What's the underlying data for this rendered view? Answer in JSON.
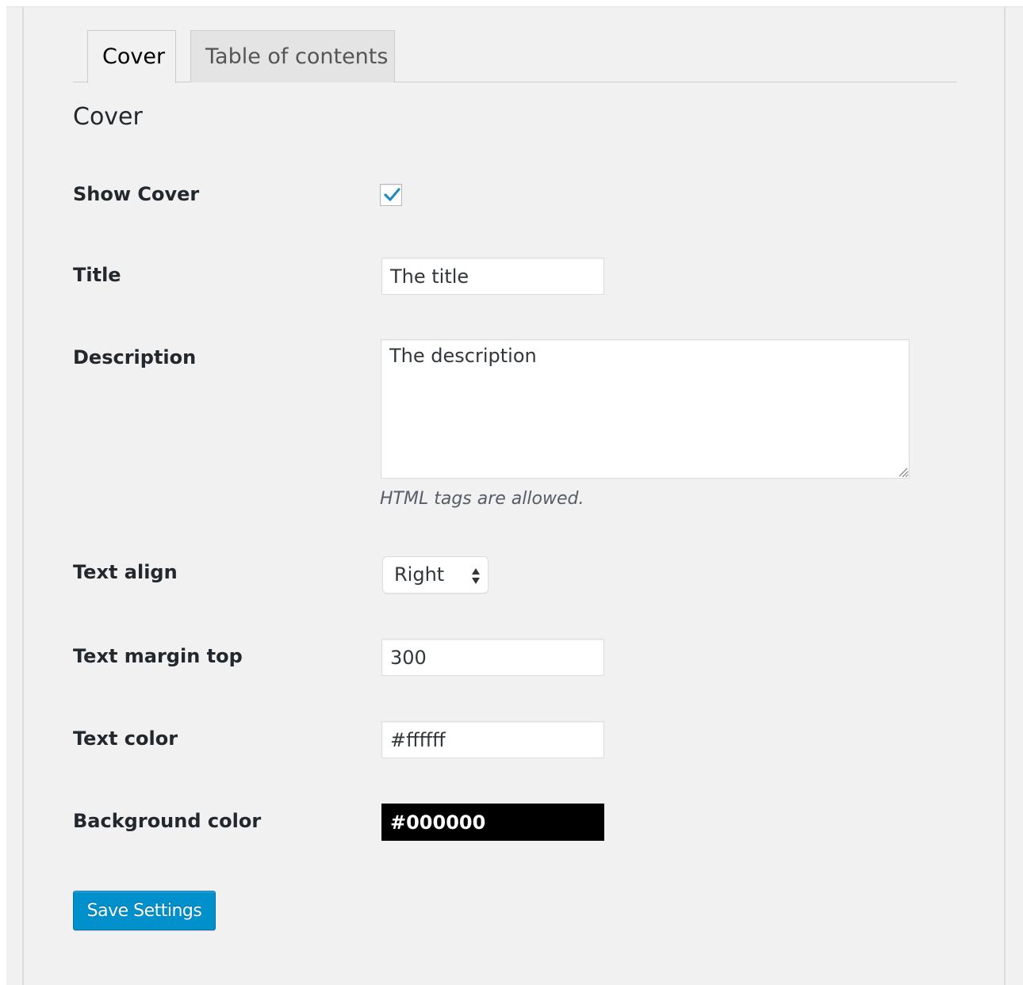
{
  "tabs": [
    {
      "label": "Cover",
      "active": true
    },
    {
      "label": "Table of contents",
      "active": false
    }
  ],
  "section_title": "Cover",
  "fields": {
    "show_cover": {
      "label": "Show Cover",
      "checked": true
    },
    "title": {
      "label": "Title",
      "value": "The title"
    },
    "description": {
      "label": "Description",
      "value": "The description",
      "hint": "HTML tags are allowed."
    },
    "text_align": {
      "label": "Text align",
      "value": "Right"
    },
    "text_margin_top": {
      "label": "Text margin top",
      "value": "300"
    },
    "text_color": {
      "label": "Text color",
      "value": "#ffffff"
    },
    "background_color": {
      "label": "Background color",
      "value": "#000000"
    }
  },
  "save_button": {
    "label": "Save Settings"
  },
  "colors": {
    "accent": "#0091cd",
    "checkmark": "#1e8cbe",
    "background": "#f1f1f1"
  },
  "icons": {
    "checkbox": "checkmark-icon",
    "select": "updown-arrows-icon",
    "resize": "resize-grip-icon"
  }
}
